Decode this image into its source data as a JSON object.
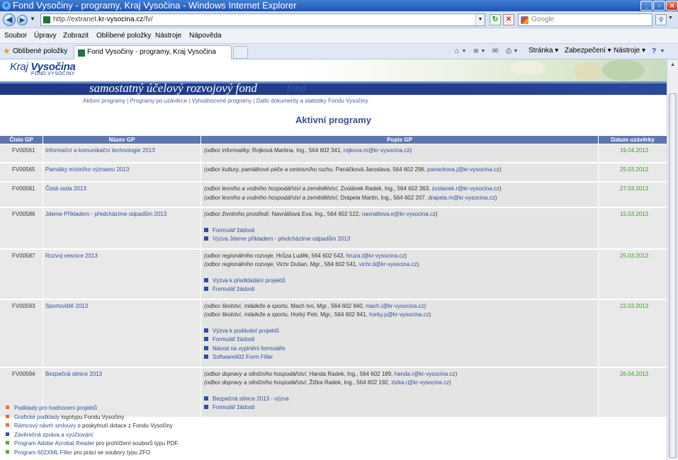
{
  "browser": {
    "window_title": "Fond Vysočiny - programy, Kraj Vysočina - Windows Internet Explorer",
    "url_prefix": "http://extranet.",
    "url_domain": "kr-vysocina.cz",
    "url_path": "/fv/",
    "search_placeholder": "Google",
    "menu": [
      "Soubor",
      "Úpravy",
      "Zobrazit",
      "Oblíbené položky",
      "Nástroje",
      "Nápověda"
    ],
    "favorites_label": "Oblíbené položky",
    "tab_title": "Fond Vysočiny - programy, Kraj Vysočina",
    "commands": {
      "page": "Stránka",
      "security": "Zabezpečení",
      "tools": "Nástroje"
    }
  },
  "site": {
    "logo_line1_a": "Kraj ",
    "logo_line1_b": "Vysočina",
    "logo_line2": "FOND VYSOČINY",
    "slogan": "samostatný účelový rozvojový fond",
    "slogan_ghost": "fond",
    "subnav": [
      "Aktivní programy",
      "Programy po uzávěrce",
      "Vyhodnocené programy",
      "Další dokumenty a statistiky Fondu Vysočiny"
    ],
    "heading": "Aktivní programy"
  },
  "table": {
    "headers": {
      "id": "Číslo GP",
      "name": "Název GP",
      "desc": "Popis GP",
      "date": "Datum uzávěrky"
    },
    "rows": [
      {
        "id": "FV00561",
        "name": "Informační a komunikační technologie 2013",
        "date": "19.04.2013",
        "contacts": [
          {
            "dept": "(odbor informatiky,",
            "person": " Rojková Martina, Ing., 564 602 341, ",
            "email": "rojkova.m@kr-vysocina.cz",
            "close": ")"
          }
        ],
        "docs": []
      },
      {
        "id": "FV00565",
        "name": "Památky místního významu 2013",
        "date": "25.03.2013",
        "contacts": [
          {
            "dept": "(odbor kultury, památkové péče a cestovního ruchu,",
            "person": " Panáčková Jaroslava, 564 602 296, ",
            "email": "panackova.j@kr-vysocina.cz",
            "close": ")"
          }
        ],
        "docs": []
      },
      {
        "id": "FV00581",
        "name": "Čistá voda 2013",
        "date": "27.03.2013",
        "contacts": [
          {
            "dept": "(odbor lesního a vodního hospodářství a zemědělství,",
            "person": " Zvolánek Radek, Ing., 564 602 363, ",
            "email": "zvolanek.r@kr-vysocina.cz",
            "close": ")"
          },
          {
            "dept": "(odbor lesního a vodního hospodářství a zemědělství,",
            "person": " Drápela Martin, Ing., 564 602 207, ",
            "email": "drapela.m@kr-vysocina.cz",
            "close": ")"
          }
        ],
        "docs": []
      },
      {
        "id": "FV00586",
        "name": "Jdeme Příkladem - předcházíme odpadům 2013",
        "date": "15.03.2013",
        "contacts": [
          {
            "dept": "(odbor životního prostředí,",
            "person": " Navrátilová Eva, Ing., 564 602 522, ",
            "email": "navratilova.e@kr-vysocina.cz",
            "close": ")"
          }
        ],
        "docs": [
          "Formulář žádosti",
          "Výzva Jdeme příkladem - předcházíme odpadům 2013"
        ]
      },
      {
        "id": "FV00587",
        "name": "Rozvoj vesnice 2013",
        "date": "25.03.2013",
        "contacts": [
          {
            "dept": "(odbor regionálního rozvoje,",
            "person": " Hrůza Luděk, 564 602 543, ",
            "email": "hruza.l@kr-vysocina.cz",
            "close": ")"
          },
          {
            "dept": "(odbor regionálního rozvoje,",
            "person": " Vichr Dušan, Mgr., 564 602 541, ",
            "email": "vichr.d@kr-vysocina.cz",
            "close": ")"
          }
        ],
        "docs": [
          "Výzva k předkládání projektů",
          "Formulář žádosti"
        ]
      },
      {
        "id": "FV00593",
        "name": "Sportoviště 2013",
        "date": "22.03.2013",
        "contacts": [
          {
            "dept": "(odbor školství, mládeže a sportu,",
            "person": " Mach Ivo, Mgr., 564 602 940, ",
            "email": "mach.i@kr-vysocina.cz",
            "close": ")"
          },
          {
            "dept": "(odbor školství, mládeže a sportu,",
            "person": " Horký Petr, Mgr., 564 602 941, ",
            "email": "horky.p@kr-vysocina.cz",
            "close": ")"
          }
        ],
        "docs": [
          "Výzva k podávání projektů",
          "Formulář žádosti",
          "Návod na vyplnění formuláře",
          "Software602 Form Filler"
        ]
      },
      {
        "id": "FV00594",
        "name": "Bezpečná silnice 2013",
        "date": "26.04.2013",
        "contacts": [
          {
            "dept": "(odbor dopravy a silničního hospodářství,",
            "person": " Handa Radek, Ing., 564 602 189, ",
            "email": "handa.r@kr-vysocina.cz",
            "close": ")"
          },
          {
            "dept": "(odbor dopravy a silničního hospodářství,",
            "person": " Žižka Radek, Ing., 564 602 192, ",
            "email": "zizka.r@kr-vysocina.cz",
            "close": ")"
          }
        ],
        "docs": [
          "Bezpečná silnice 2013 - výzva",
          "Formulář žádosti"
        ]
      }
    ]
  },
  "footer_links": [
    {
      "link": "Podklady pro hodnocení projektů",
      "rest": "",
      "color": "#e8722a"
    },
    {
      "link": "Grafické podklady",
      "rest": " logotypu Fondu Vysočiny",
      "color": "#e8722a"
    },
    {
      "link": "Rámcový návrh smlouvy",
      "rest": " o poskytnutí dotace z Fondu Vysočiny",
      "color": "#e8722a"
    },
    {
      "link": "Závěrečná zpráva a vyúčtování",
      "rest": "",
      "color": "#2e4d9e"
    },
    {
      "link": "Program Adobe Acrobat Reader",
      "rest": " pro prohlížení souborů typu PDF.",
      "color": "#5aaa2a"
    },
    {
      "link": "Program 602XML Filler",
      "rest": " pro práci se soubory typu ZFO",
      "color": "#5aaa2a"
    }
  ]
}
